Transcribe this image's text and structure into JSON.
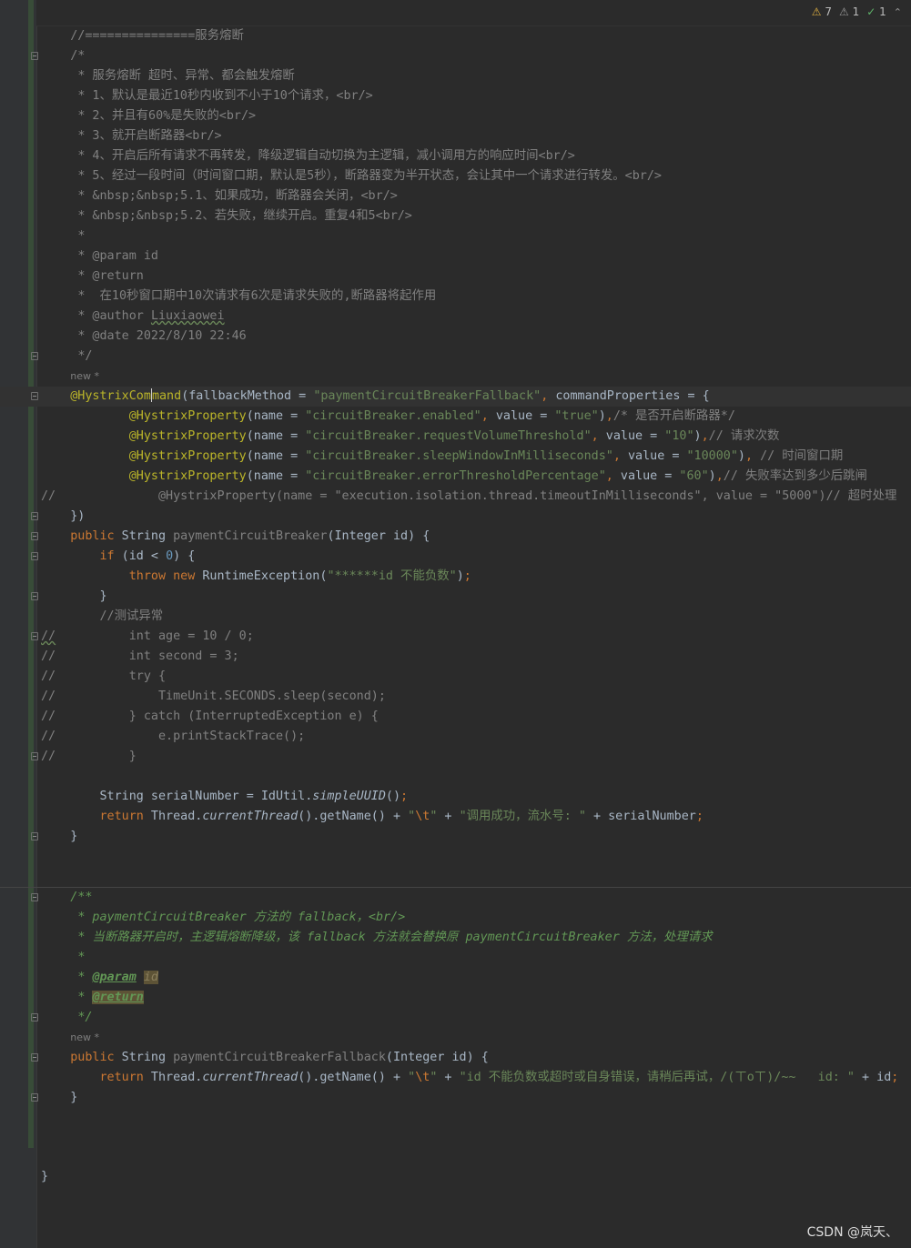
{
  "inspections": {
    "warnings": "7",
    "weak_warnings": "1",
    "typos": "1"
  },
  "lines": [
    {
      "html": "    <span class=\"cm\">//===============服务熔断</span>"
    },
    {
      "fold": true,
      "html": "    <span class=\"cm\">/*</span>"
    },
    {
      "html": "     <span class=\"cm\">* 服务熔断 超时、异常、都会触发熔断</span>"
    },
    {
      "html": "     <span class=\"cm\">* 1、默认是最近10秒内收到不小于10个请求，&lt;br/&gt;</span>"
    },
    {
      "html": "     <span class=\"cm\">* 2、并且有60%是失败的&lt;br/&gt;</span>"
    },
    {
      "html": "     <span class=\"cm\">* 3、就开启断路器&lt;br/&gt;</span>"
    },
    {
      "html": "     <span class=\"cm\">* 4、开启后所有请求不再转发，降级逻辑自动切换为主逻辑，减小调用方的响应时间&lt;br/&gt;</span>"
    },
    {
      "html": "     <span class=\"cm\">* 5、经过一段时间（时间窗口期，默认是5秒），断路器变为半开状态，会让其中一个请求进行转发。&lt;br/&gt;</span>"
    },
    {
      "html": "     <span class=\"cm\">* &amp;nbsp;&amp;nbsp;5.1、如果成功，断路器会关闭，&lt;br/&gt;</span>"
    },
    {
      "html": "     <span class=\"cm\">* &amp;nbsp;&amp;nbsp;5.2、若失败，继续开启。重复4和5&lt;br/&gt;</span>"
    },
    {
      "html": "     <span class=\"cm\">*</span>"
    },
    {
      "html": "     <span class=\"cm\">* @param id</span>"
    },
    {
      "html": "     <span class=\"cm\">* @return</span>"
    },
    {
      "html": "     <span class=\"cm\">*  在10秒窗口期中10次请求有6次是请求失败的,断路器将起作用</span>"
    },
    {
      "html": "     <span class=\"cm\">* @author <span class=\"wavy\">Liuxiaowei</span></span>"
    },
    {
      "html": "     <span class=\"cm\">* @date 2022/8/10 22:46</span>"
    },
    {
      "fold": true,
      "html": "     <span class=\"cm\">*/</span>"
    },
    {
      "hint": true,
      "html": "    <span class=\"hint\">new *</span>"
    },
    {
      "fold": true,
      "cur": true,
      "html": "    <span class=\"ann\">@HystrixCom<span class=\"caret\"></span>mand</span>(fallbackMethod = <span class=\"str\">\"paymentCircuitBreakerFallback\"</span><span class=\"kw\">,</span> commandProperties = {"
    },
    {
      "html": "            <span class=\"ann\">@HystrixProperty</span>(name = <span class=\"str\">\"circuitBreaker.enabled\"</span><span class=\"kw\">,</span> value = <span class=\"str\">\"true\"</span>)<span class=\"kw\">,</span><span class=\"cm\">/* 是否开启断路器*/</span>"
    },
    {
      "html": "            <span class=\"ann\">@HystrixProperty</span>(name = <span class=\"str\">\"circuitBreaker.requestVolumeThreshold\"</span><span class=\"kw\">,</span> value = <span class=\"str\">\"10\"</span>)<span class=\"kw\">,</span><span class=\"cm\">// 请求次数</span>"
    },
    {
      "html": "            <span class=\"ann\">@HystrixProperty</span>(name = <span class=\"str\">\"circuitBreaker.sleepWindowInMilliseconds\"</span><span class=\"kw\">,</span> value = <span class=\"str\">\"10000\"</span>)<span class=\"kw\">,</span> <span class=\"cm\">// 时间窗口期</span>"
    },
    {
      "html": "            <span class=\"ann\">@HystrixProperty</span>(name = <span class=\"str\">\"circuitBreaker.errorThresholdPercentage\"</span><span class=\"kw\">,</span> value = <span class=\"str\">\"60\"</span>)<span class=\"kw\">,</span><span class=\"cm\">// 失败率达到多少后跳闸</span>"
    },
    {
      "html": "<span class=\"lc\">//              @HystrixProperty(name = \"execution.isolation.thread.timeoutInMilliseconds\", value = \"5000\")// 超时处理</span>"
    },
    {
      "fold": true,
      "html": "    })"
    },
    {
      "fold": true,
      "html": "    <span class=\"kw\">public</span> String <span class=\"gray\">paymentCircuitBreaker</span>(Integer id) {"
    },
    {
      "fold": true,
      "html": "        <span class=\"kw\">if</span> (id &lt; <span class=\"num\">0</span>) {"
    },
    {
      "html": "            <span class=\"kw\">throw new</span> RuntimeException(<span class=\"str\">\"******id 不能负数\"</span>)<span class=\"kw\">;</span>"
    },
    {
      "fold": true,
      "html": "        }"
    },
    {
      "html": "        <span class=\"cm\">//测试异常</span>"
    },
    {
      "fold": true,
      "html": "<span class=\"lc\"><span class=\"wavy\">//</span>          int age = 10 / 0;</span>"
    },
    {
      "html": "<span class=\"lc\">//          int second = 3;</span>"
    },
    {
      "html": "<span class=\"lc\">//          try {</span>"
    },
    {
      "html": "<span class=\"lc\">//              TimeUnit.SECONDS.sleep(second);</span>"
    },
    {
      "html": "<span class=\"lc\">//          } catch (InterruptedException e) {</span>"
    },
    {
      "html": "<span class=\"lc\">//              e.printStackTrace();</span>"
    },
    {
      "fold": true,
      "html": "<span class=\"lc\">//          }</span>"
    },
    {
      "html": ""
    },
    {
      "html": "        String serialNumber = IdUtil.<span class=\"it\">simpleUUID</span>()<span class=\"kw\">;</span>"
    },
    {
      "html": "        <span class=\"kw\">return</span> Thread.<span class=\"it\">currentThread</span>().getName() + <span class=\"str\">\"</span><span class=\"kw\">\\t</span><span class=\"str\">\"</span> + <span class=\"str\">\"调用成功，流水号: \"</span> + serialNumber<span class=\"kw\">;</span>"
    },
    {
      "fold": true,
      "html": "    }"
    },
    {
      "html": ""
    },
    {
      "sep": true,
      "html": ""
    },
    {
      "fold": true,
      "html": "    <span class=\"cmi\">/**</span>"
    },
    {
      "html": "     <span class=\"cmi\">* paymentCircuitBreaker 方法的 fallback，&lt;br/&gt;</span>"
    },
    {
      "html": "     <span class=\"cmi\">* 当断路器开启时，主逻辑熔断降级，该 fallback 方法就会替换原 paymentCircuitBreaker 方法，处理请求</span>"
    },
    {
      "html": "     <span class=\"cmi\">*</span>"
    },
    {
      "html": "     <span class=\"cmi\">* </span><span class=\"dtag\">@param</span> <span class=\"dval dhl\">id</span>"
    },
    {
      "html": "     <span class=\"cmi\">* </span><span class=\"dtag dhl\">@return</span>"
    },
    {
      "fold": true,
      "html": "     <span class=\"cmi\">*/</span>"
    },
    {
      "hint": true,
      "html": "    <span class=\"hint\">new *</span>"
    },
    {
      "fold": true,
      "html": "    <span class=\"kw\">public</span> String <span class=\"gray\">paymentCircuitBreakerFallback</span>(Integer id) {"
    },
    {
      "html": "        <span class=\"kw\">return</span> Thread.<span class=\"it\">currentThread</span>().getName() + <span class=\"str\">\"</span><span class=\"kw\">\\t</span><span class=\"str\">\"</span> + <span class=\"str\">\"id 不能负数或超时或自身错误，请稍后再试，/(ㄒoㄒ)/~~   id: \"</span> + id<span class=\"kw\">;</span>"
    },
    {
      "fold": true,
      "html": "    }"
    }
  ],
  "closing_brace": "}",
  "watermark": "CSDN @岚天、"
}
